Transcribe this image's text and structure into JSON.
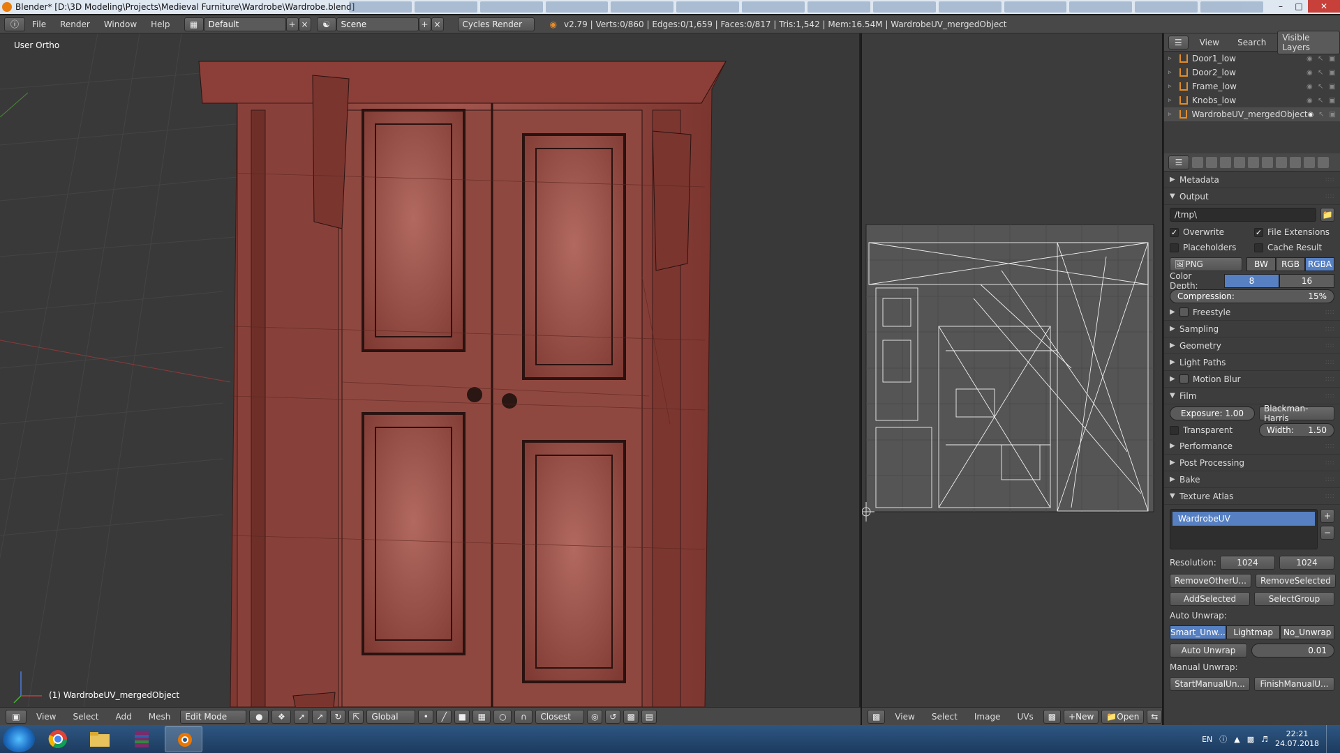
{
  "window": {
    "title": "Blender* [D:\\3D Modeling\\Projects\\Medieval Furniture\\Wardrobe\\Wardrobe.blend]"
  },
  "info": {
    "menus": [
      "File",
      "Render",
      "Window",
      "Help"
    ],
    "layout": "Default",
    "scene": "Scene",
    "engine": "Cycles Render",
    "stats": "v2.79 | Verts:0/860 | Edges:0/1,659 | Faces:0/817 | Tris:1,542 | Mem:16.54M | WardrobeUV_mergedObject"
  },
  "view3d": {
    "label": "User Ortho",
    "object_label": "(1) WardrobeUV_mergedObject",
    "mesh_color": "#8a3d36",
    "header": {
      "menus": [
        "View",
        "Select",
        "Add",
        "Mesh"
      ],
      "mode": "Edit Mode",
      "orientation": "Global",
      "snap": "Closest"
    }
  },
  "image_editor": {
    "header": {
      "menus": [
        "View",
        "Select",
        "Image",
        "UVs"
      ],
      "new": "New",
      "open": "Open"
    }
  },
  "outliner": {
    "header": {
      "view": "View",
      "search": "Search",
      "filter": "Visible Layers"
    },
    "items": [
      {
        "name": "Door1_low"
      },
      {
        "name": "Door2_low"
      },
      {
        "name": "Frame_low"
      },
      {
        "name": "Knobs_low"
      },
      {
        "name": "WardrobeUV_mergedObject"
      }
    ]
  },
  "properties": {
    "metadata": "Metadata",
    "output": {
      "label": "Output",
      "path": "/tmp\\",
      "overwrite": "Overwrite",
      "file_extensions": "File Extensions",
      "placeholders": "Placeholders",
      "cache_result": "Cache Result",
      "format": "PNG",
      "bw": "BW",
      "rgb": "RGB",
      "rgba": "RGBA",
      "color_depth_label": "Color Depth:",
      "depth_8": "8",
      "depth_16": "16",
      "compression_label": "Compression:",
      "compression": "15%"
    },
    "freestyle": "Freestyle",
    "sampling": "Sampling",
    "geometry": "Geometry",
    "light_paths": "Light Paths",
    "motion_blur": "Motion Blur",
    "film": {
      "label": "Film",
      "exposure": "Exposure: 1.00",
      "filter": "Blackman-Harris",
      "transparent": "Transparent",
      "width": "Width:",
      "width_val": "1.50"
    },
    "performance": "Performance",
    "post_processing": "Post Processing",
    "bake": "Bake",
    "atlas": {
      "label": "Texture Atlas",
      "item": "WardrobeUV",
      "resolution_label": "Resolution:",
      "res_x": "1024",
      "res_y": "1024",
      "remove_other": "RemoveOtherU...",
      "remove_selected": "RemoveSelected",
      "add_selected": "AddSelected",
      "select_group": "SelectGroup",
      "auto_unwrap_label": "Auto Unwrap:",
      "smart": "Smart_Unw...",
      "lightmap": "Lightmap",
      "no_unwrap": "No_Unwrap",
      "auto_unwrap_btn": "Auto Unwrap",
      "margin": "0.01",
      "manual_unwrap_label": "Manual Unwrap:",
      "start_manual": "StartManualUn...",
      "finish_manual": "FinishManualU..."
    }
  },
  "taskbar": {
    "lang": "EN",
    "time": "22:21",
    "date": "24.07.2018"
  }
}
